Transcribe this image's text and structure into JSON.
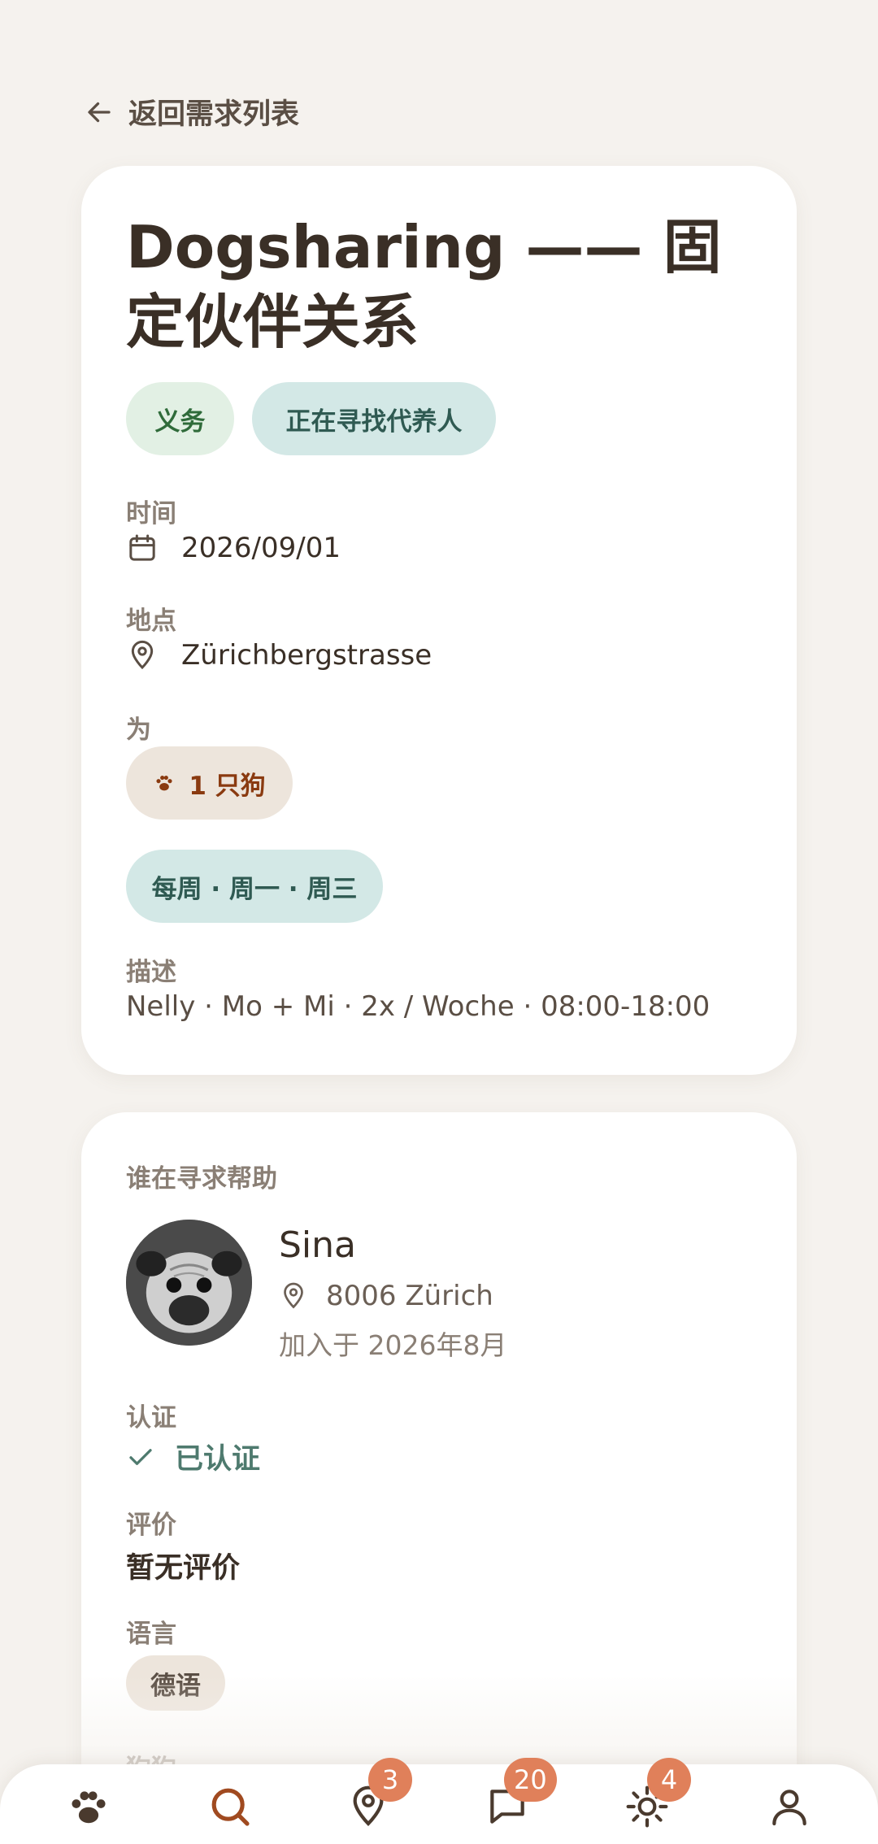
{
  "nav": {
    "back_label": "返回需求列表"
  },
  "request": {
    "title": "Dogsharing —— 固定伙伴关系",
    "tags": [
      "义务",
      "正在寻找代养人"
    ],
    "time_label": "时间",
    "time_value": "2026/09/01",
    "place_label": "地点",
    "place_value": "Zürichbergstrasse",
    "for_label": "为",
    "dogs_chip": "1 只狗",
    "schedule_chip": "每周 · 周一 · 周三",
    "desc_label": "描述",
    "desc_value": "Nelly · Mo + Mi · 2x / Woche · 08:00-18:00"
  },
  "requester": {
    "section_label": "谁在寻求帮助",
    "name": "Sina",
    "location": "8006 Zürich",
    "joined": "加入于 2026年8月",
    "verify_label": "认证",
    "verify_value": "已认证",
    "rating_label": "评价",
    "rating_value": "暂无评价",
    "language_label": "语言",
    "language_chip": "德语",
    "dogs_label": "狗狗"
  },
  "tabbar": {
    "items": [
      {
        "icon": "paw-icon",
        "badge": null
      },
      {
        "icon": "search-icon",
        "badge": null
      },
      {
        "icon": "map-pin-icon",
        "badge": "3"
      },
      {
        "icon": "chat-icon",
        "badge": "20"
      },
      {
        "icon": "sun-icon",
        "badge": "4"
      },
      {
        "icon": "profile-icon",
        "badge": null
      }
    ]
  },
  "colors": {
    "background": "#f5f2ee",
    "text_primary": "#3a2f26",
    "muted": "#8a7f75",
    "tag_green_bg": "#e2f0e4",
    "tag_green_fg": "#2f6b3a",
    "tag_teal_bg": "#d3e8e6",
    "tag_teal_fg": "#2f5a52",
    "dog_chip_bg": "#ede5dc",
    "dog_chip_fg": "#8a3a10",
    "accent_orange": "#e0805a",
    "verified_green": "#4e7a6e"
  }
}
